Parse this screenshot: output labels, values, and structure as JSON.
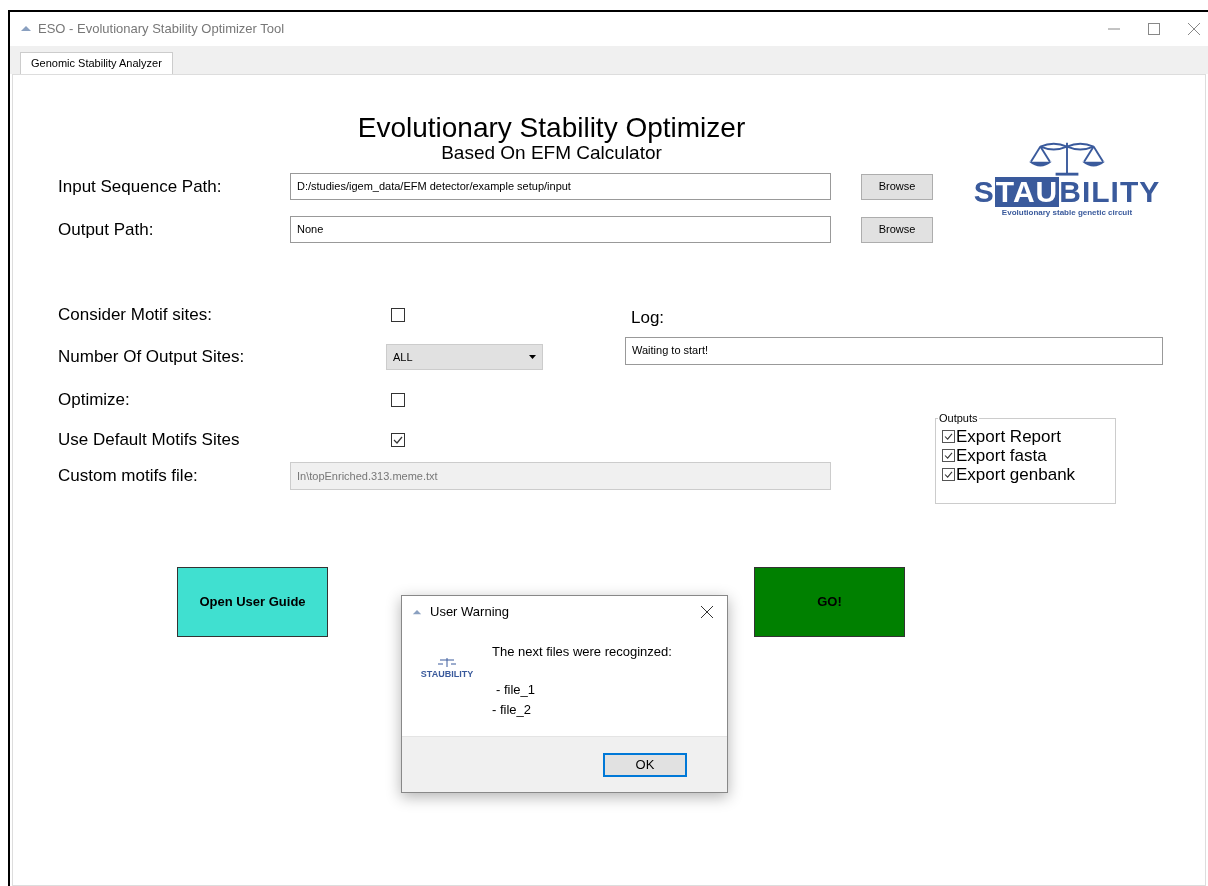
{
  "window": {
    "title": "ESO - Evolutionary Stability Optimizer Tool"
  },
  "tabs": [
    {
      "label": "Genomic Stability Analyzer",
      "selected": true
    }
  ],
  "header": {
    "title": "Evolutionary Stability Optimizer",
    "subtitle": "Based On EFM Calculator"
  },
  "logo": {
    "parts": [
      {
        "text": "S",
        "boxed": false
      },
      {
        "text": "TAU",
        "boxed": true
      },
      {
        "text": "BILITY",
        "boxed": false
      }
    ],
    "tagline": "Evolutionary stable genetic circuit"
  },
  "paths": [
    {
      "label": "Input Sequence Path:",
      "value": "D:/studies/igem_data/EFM detector/example setup/input",
      "button": "Browse"
    },
    {
      "label": "Output Path:",
      "value": "None",
      "button": "Browse"
    }
  ],
  "options": [
    {
      "kind": "checkbox",
      "label": "Consider Motif sites:",
      "checked": false
    },
    {
      "kind": "dropdown",
      "label": "Number Of Output Sites:",
      "value": "ALL"
    },
    {
      "kind": "checkbox",
      "label": "Optimize:",
      "checked": false
    },
    {
      "kind": "checkbox",
      "label": "Use Default Motifs Sites",
      "checked": true
    },
    {
      "kind": "field",
      "label": "Custom motifs file:",
      "value": "In\\topEnriched.313.meme.txt",
      "disabled": true
    }
  ],
  "log": {
    "label": "Log:",
    "value": "Waiting to start!"
  },
  "outputs": {
    "title": "Outputs",
    "items": [
      {
        "label": "Export Report",
        "checked": true
      },
      {
        "label": "Export fasta",
        "checked": true
      },
      {
        "label": "Export genbank",
        "checked": true
      }
    ]
  },
  "buttons": [
    {
      "label": "Open User Guide",
      "color": "#40e0d0"
    },
    {
      "label": "GO!",
      "color": "#008000"
    }
  ],
  "dialog": {
    "title": "User Warning",
    "logo_text": "STAUBILITY",
    "message": "The next files were recoginzed:",
    "files": [
      "- file_1",
      "- file_2"
    ],
    "button": "OK"
  }
}
